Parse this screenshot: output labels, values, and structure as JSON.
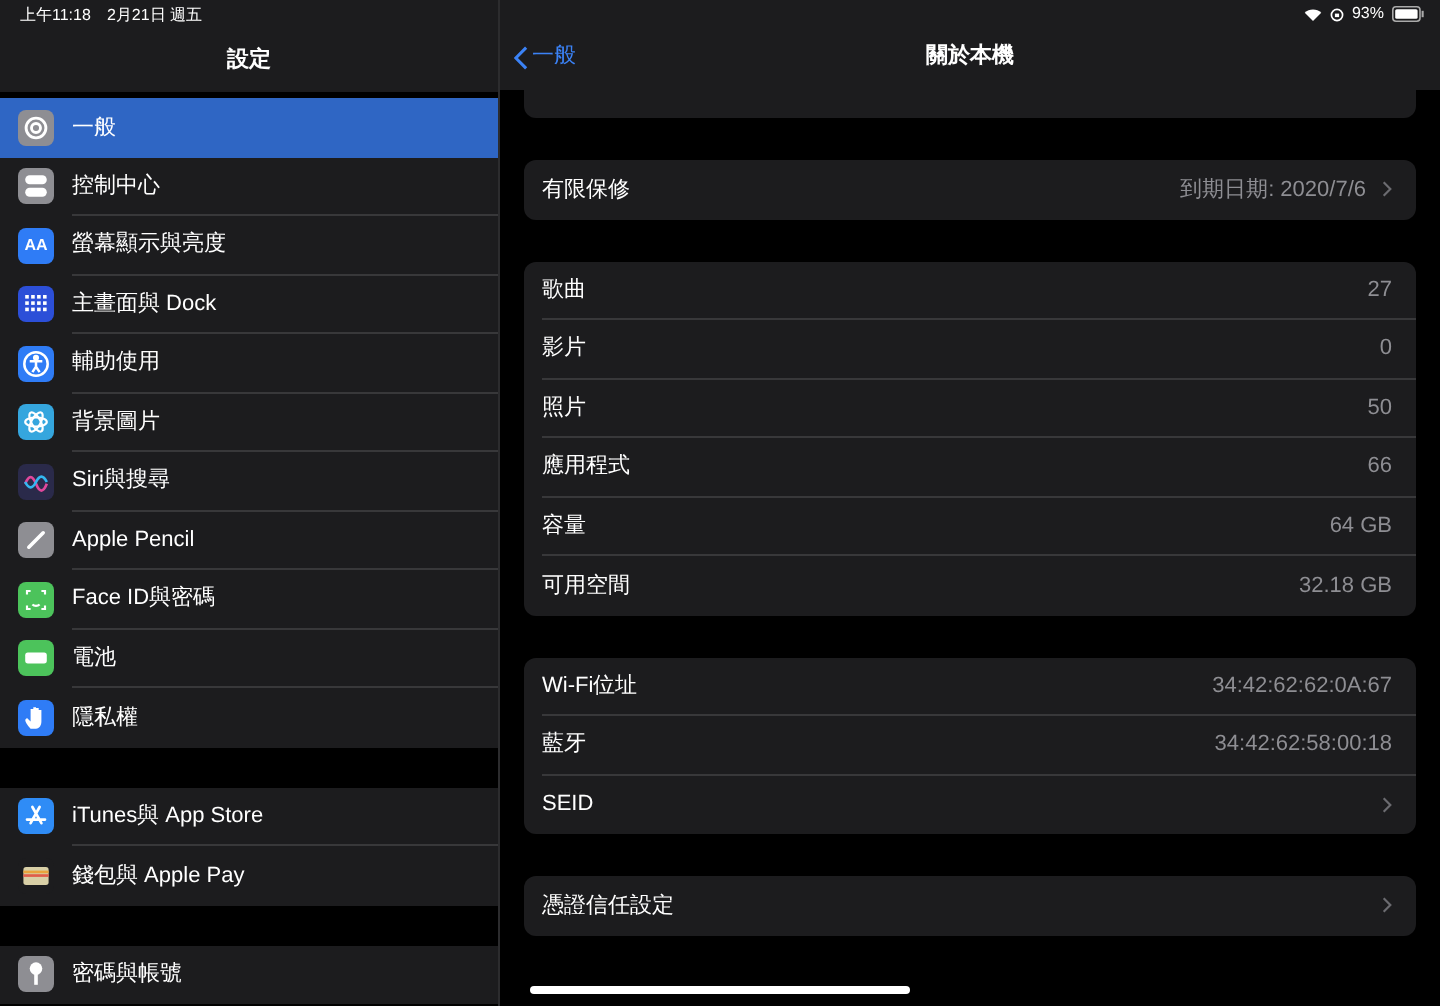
{
  "status_bar": {
    "time": "上午11:18",
    "date": "2月21日 週五",
    "battery": "93%"
  },
  "sidebar": {
    "title": "設定",
    "groups": [
      [
        {
          "label": "一般",
          "kind": "gear",
          "color": "#8e8e93",
          "selected": true
        },
        {
          "label": "控制中心",
          "kind": "toggles",
          "color": "#8e8e93",
          "selected": false
        },
        {
          "label": "螢幕顯示與亮度",
          "kind": "letters",
          "icon_text": "AA",
          "color": "#2f7cf6",
          "selected": false
        },
        {
          "label": "主畫面與 Dock",
          "kind": "grid",
          "color": "#2c4fd8",
          "selected": false
        },
        {
          "label": "輔助使用",
          "kind": "person",
          "color": "#2f7cf6",
          "selected": false
        },
        {
          "label": "背景圖片",
          "kind": "flower",
          "color": "#35a6de",
          "selected": false
        },
        {
          "label": "Siri與搜尋",
          "kind": "siri",
          "color": "#2a2a4a",
          "selected": false
        },
        {
          "label": "Apple Pencil",
          "kind": "pencil",
          "color": "#8e8e93",
          "selected": false
        },
        {
          "label": "Face ID與密碼",
          "kind": "face",
          "color": "#4cc35b",
          "selected": false
        },
        {
          "label": "電池",
          "kind": "battery",
          "color": "#4cc35b",
          "selected": false
        },
        {
          "label": "隱私權",
          "kind": "hand",
          "color": "#2f7cf6",
          "selected": false
        }
      ],
      [
        {
          "label": "iTunes與 App Store",
          "kind": "appstore",
          "color": "#2f8cf6",
          "selected": false
        },
        {
          "label": "錢包與 Apple Pay",
          "kind": "wallet",
          "color": "#1c1c1e",
          "selected": false
        }
      ],
      [
        {
          "label": "密碼與帳號",
          "kind": "key",
          "color": "#8e8e93",
          "selected": false
        }
      ]
    ]
  },
  "nav": {
    "back": "一般",
    "title": "關於本機"
  },
  "sections": [
    [
      {
        "label": "有限保修",
        "value": "到期日期: 2020/7/6",
        "chevron": true
      }
    ],
    [
      {
        "label": "歌曲",
        "value": "27",
        "chevron": false
      },
      {
        "label": "影片",
        "value": "0",
        "chevron": false
      },
      {
        "label": "照片",
        "value": "50",
        "chevron": false
      },
      {
        "label": "應用程式",
        "value": "66",
        "chevron": false
      },
      {
        "label": "容量",
        "value": "64 GB",
        "chevron": false
      },
      {
        "label": "可用空間",
        "value": "32.18 GB",
        "chevron": false
      }
    ],
    [
      {
        "label": "Wi-Fi位址",
        "value": "34:42:62:62:0A:67",
        "chevron": false
      },
      {
        "label": "藍牙",
        "value": "34:42:62:58:00:18",
        "chevron": false
      },
      {
        "label": "SEID",
        "chevron": true
      }
    ],
    [
      {
        "label": "憑證信任設定",
        "chevron": true
      }
    ]
  ]
}
